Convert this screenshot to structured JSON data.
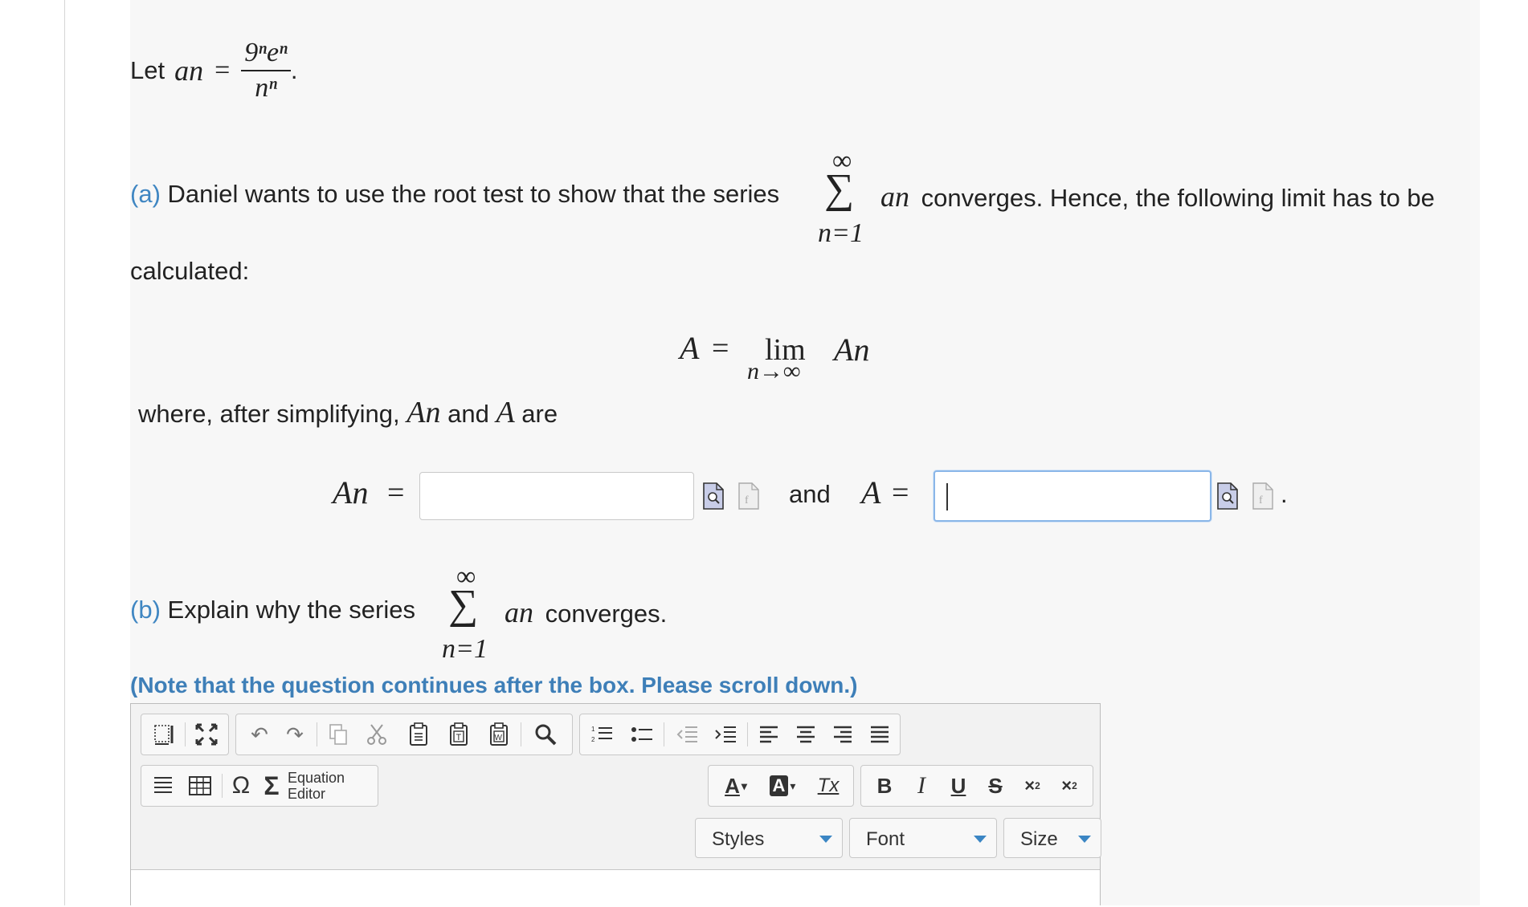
{
  "problem": {
    "intro_prefix": "Let",
    "a_label": "a",
    "n_sub": "n",
    "equals": "=",
    "frac_num": "9ⁿeⁿ",
    "frac_den": "nⁿ",
    "period": "."
  },
  "part_a": {
    "marker": "(a)",
    "text_before_sum": "Daniel wants to use the root test to show that the series",
    "sum_top": "∞",
    "sum_symbol": "∑",
    "sum_bottom": "n=1",
    "text_after_sum": "converges. Hence, the following limit has to be",
    "text_line2": "calculated:",
    "limit_lhs": "A",
    "limit_word": "lim",
    "limit_sub": "n→∞",
    "limit_rhs": "A",
    "where_text_1": "where, after simplifying,",
    "where_and": "and",
    "where_A": "A",
    "where_text_2": "are",
    "answer_and": "and",
    "answer_end": ".",
    "input_An": {
      "value": "",
      "placeholder": ""
    },
    "input_A": {
      "value": "",
      "placeholder": ""
    }
  },
  "part_b": {
    "marker": "(b)",
    "text_before_sum": "Explain why the series",
    "text_after_sum": "converges.",
    "note": "(Note that the question continues after the box. Please scroll down.)"
  },
  "editor": {
    "equation_editor_label_1": "Equation",
    "equation_editor_label_2": "Editor",
    "styles_label": "Styles",
    "font_label": "Font",
    "size_label": "Size",
    "bold": "B",
    "italic": "I",
    "underline": "U",
    "strike": "S",
    "text_color": "A",
    "bg_color": "A",
    "remove_format": "Tx",
    "omega": "Ω",
    "sigma": "Σ"
  },
  "colors": {
    "part_marker": "#3f86c2",
    "note": "#3e7fb8",
    "dropdown_arrow": "#3b86c4",
    "focus_border": "#8ab6e8"
  }
}
